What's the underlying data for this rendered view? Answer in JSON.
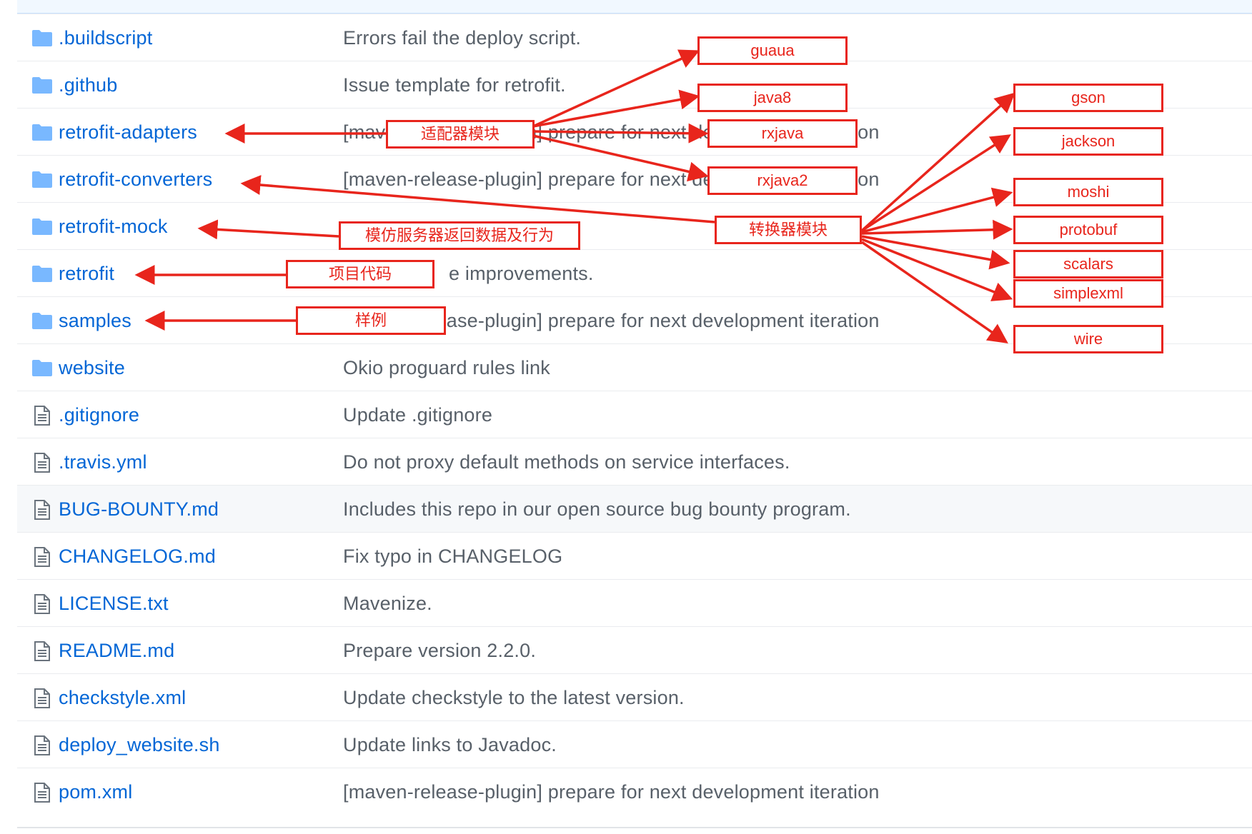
{
  "files": [
    {
      "name": ".buildscript",
      "message": "Errors fail the deploy script.",
      "type": "folder",
      "icon": "folder-icon"
    },
    {
      "name": ".github",
      "message": "Issue template for retrofit.",
      "type": "folder",
      "icon": "folder-icon"
    },
    {
      "name": "retrofit-adapters",
      "message": "[maven-release-plugin] prepare for next development iteration",
      "type": "folder",
      "icon": "folder-icon"
    },
    {
      "name": "retrofit-converters",
      "message": "[maven-release-plugin] prepare for next development iteration",
      "type": "folder",
      "icon": "folder-icon"
    },
    {
      "name": "retrofit-mock",
      "message": "",
      "type": "folder",
      "icon": "folder-icon"
    },
    {
      "name": "retrofit",
      "message": "e improvements.",
      "type": "folder",
      "icon": "folder-icon"
    },
    {
      "name": "samples",
      "message": "[maven-release-plugin] prepare for next development iteration",
      "type": "folder",
      "icon": "folder-icon"
    },
    {
      "name": "website",
      "message": "Okio proguard rules link",
      "type": "folder",
      "icon": "folder-icon"
    },
    {
      "name": ".gitignore",
      "message": "Update .gitignore",
      "type": "file",
      "icon": "file-icon"
    },
    {
      "name": ".travis.yml",
      "message": "Do not proxy default methods on service interfaces.",
      "type": "file",
      "icon": "file-icon"
    },
    {
      "name": "BUG-BOUNTY.md",
      "message": "Includes this repo in our open source bug bounty program.",
      "type": "file",
      "icon": "file-icon",
      "highlighted": true
    },
    {
      "name": "CHANGELOG.md",
      "message": "Fix typo in CHANGELOG",
      "type": "file",
      "icon": "file-icon"
    },
    {
      "name": "LICENSE.txt",
      "message": "Mavenize.",
      "type": "file",
      "icon": "file-icon"
    },
    {
      "name": "README.md",
      "message": "Prepare version 2.2.0.",
      "type": "file",
      "icon": "file-icon"
    },
    {
      "name": "checkstyle.xml",
      "message": "Update checkstyle to the latest version.",
      "type": "file",
      "icon": "file-icon"
    },
    {
      "name": "deploy_website.sh",
      "message": "Update links to Javadoc.",
      "type": "file",
      "icon": "file-icon"
    },
    {
      "name": "pom.xml",
      "message": "[maven-release-plugin] prepare for next development iteration",
      "type": "file",
      "icon": "file-icon"
    }
  ],
  "annotations": {
    "adapters": "适配器模块",
    "converters": "转换器模块",
    "mock": "模仿服务器返回数据及行为",
    "project_code": "项目代码",
    "samples": "样例",
    "adapter_list": [
      "guaua",
      "java8",
      "rxjava",
      "rxjava2"
    ],
    "converter_list": [
      "gson",
      "jackson",
      "moshi",
      "protobuf",
      "scalars",
      "simplexml",
      "wire"
    ]
  },
  "colors": {
    "link": "#0366d6",
    "message": "#586069",
    "annotation": "#e8251c",
    "folder_icon": "#79b8ff",
    "row_border": "#eaecef"
  }
}
